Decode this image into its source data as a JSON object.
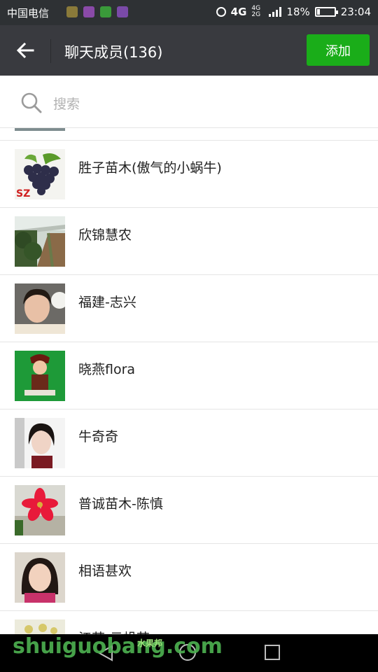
{
  "status_bar": {
    "carrier": "中国电信",
    "network": "4G",
    "network_small": "4G 2G",
    "battery": "18%",
    "time": "23:04"
  },
  "header": {
    "title": "聊天成员(136)",
    "add_label": "添加"
  },
  "search": {
    "placeholder": "搜索"
  },
  "members": [
    {
      "name": "胜子苗木(傲气的小蜗牛)",
      "avatar": "grapes-avatar"
    },
    {
      "name": "欣锦慧农",
      "avatar": "vineyard-avatar"
    },
    {
      "name": "福建-志兴",
      "avatar": "portrait-avatar"
    },
    {
      "name": "晓燕flora",
      "avatar": "child-avatar"
    },
    {
      "name": "牛奇奇",
      "avatar": "girl-avatar"
    },
    {
      "name": "普诚苗木-陈慎",
      "avatar": "flower-avatar"
    },
    {
      "name": "相语甚欢",
      "avatar": "woman-avatar"
    },
    {
      "name": "江苏-云帆苗",
      "avatar": "partial-avatar"
    }
  ],
  "watermark": {
    "text": "shuiguobang.com",
    "small_text": "水果邦"
  },
  "colors": {
    "accent_green": "#1aad19",
    "title_bar": "#393a3f",
    "status_bar": "#2e3134"
  }
}
